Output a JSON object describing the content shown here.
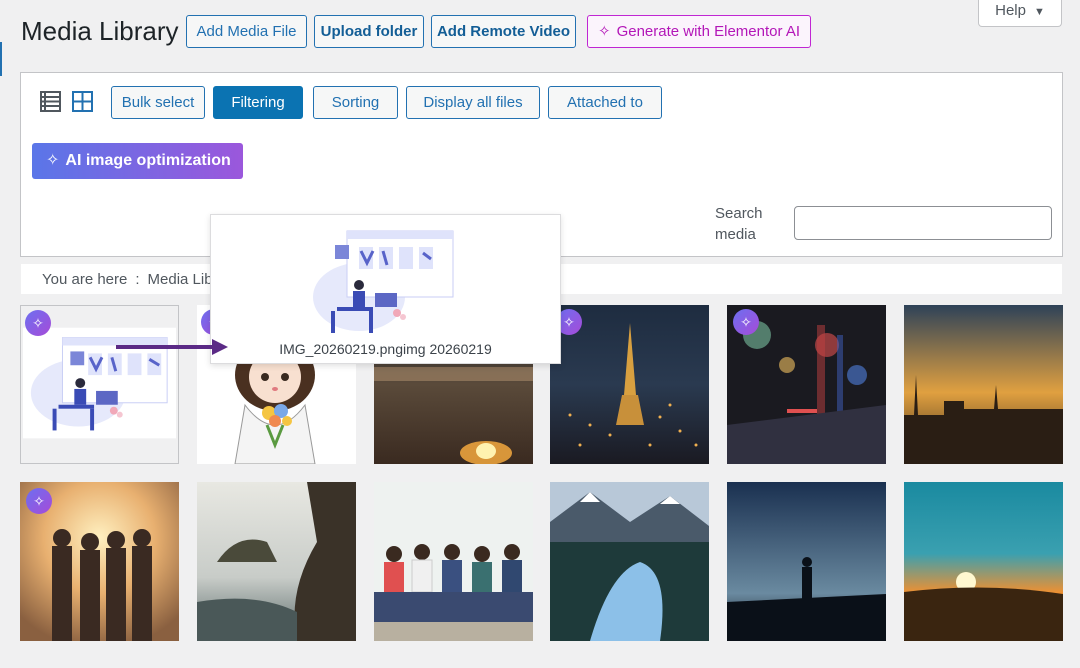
{
  "page": {
    "title": "Media Library"
  },
  "header_buttons": {
    "add_media": "Add Media File",
    "upload_folder": "Upload folder",
    "add_remote": "Add Remote Video",
    "generate_ai": "Generate with Elementor AI"
  },
  "help": {
    "label": "Help"
  },
  "toolbar": {
    "bulk_select": "Bulk select",
    "filtering": "Filtering",
    "sorting": "Sorting",
    "display_all": "Display all files",
    "attached_to": "Attached to",
    "active_tab": "Filtering"
  },
  "ai_optimization": {
    "label": "AI image optimization"
  },
  "search": {
    "label": "Search media",
    "value": ""
  },
  "breadcrumb": {
    "prefix": "You are here",
    "separator": ":",
    "current": "Media Library"
  },
  "tooltip": {
    "caption": "IMG_20260219.pngimg 20260219"
  },
  "grid": {
    "items": [
      {
        "name": "illustration-ecommerce",
        "ai_badge": true
      },
      {
        "name": "cartoon-girl-flowers",
        "ai_badge": true
      },
      {
        "name": "beach-fire-sunset",
        "ai_badge": false
      },
      {
        "name": "paris-eiffel-night",
        "ai_badge": true
      },
      {
        "name": "city-street-bokeh",
        "ai_badge": true
      },
      {
        "name": "city-skyline-sunset",
        "ai_badge": false
      },
      {
        "name": "friends-sunset",
        "ai_badge": true
      },
      {
        "name": "rocky-coast",
        "ai_badge": false
      },
      {
        "name": "group-on-bench",
        "ai_badge": false
      },
      {
        "name": "mountain-lake",
        "ai_badge": false
      },
      {
        "name": "silhouette-hill",
        "ai_badge": false
      },
      {
        "name": "sunset-horizon",
        "ai_badge": false
      }
    ]
  },
  "colors": {
    "accent": "#2271b1",
    "active": "#0b73b2",
    "ai_magenta": "#b316b8"
  }
}
